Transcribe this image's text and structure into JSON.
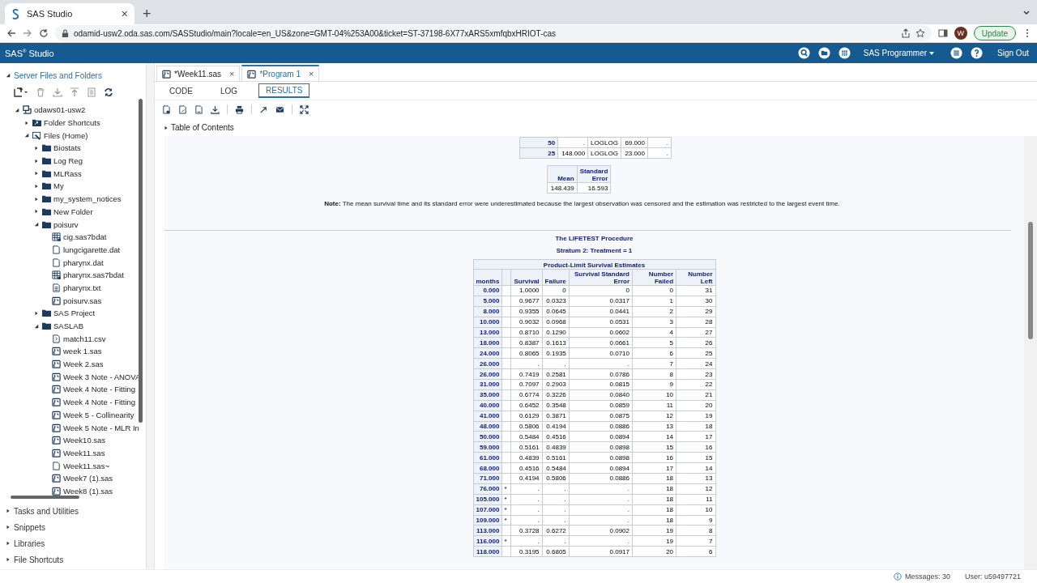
{
  "browser": {
    "tab": {
      "title": "SAS Studio",
      "close": "×"
    },
    "new_tab": "+",
    "url": "odamid-usw2.oda.sas.com/SASStudio/main?locale=en_US&zone=GMT-04%253A00&ticket=ST-37198-6X77xARS5xmfqbxHRIOT-cas",
    "avatar": "W",
    "update_button": "Update"
  },
  "app_header": {
    "product": "SAS",
    "product_mark": "®",
    "product_suffix": "Studio",
    "role": "SAS Programmer",
    "sign_out": "Sign Out"
  },
  "sidebar": {
    "title": "Server Files and Folders",
    "expanded": true,
    "tree": [
      {
        "label": "odaws01-usw2",
        "kind": "server",
        "expanded": true,
        "children": [
          {
            "label": "Folder Shortcuts",
            "kind": "shortcut",
            "expanded": false
          },
          {
            "label": "Files (Home)",
            "kind": "home",
            "expanded": true,
            "children": [
              {
                "label": "Biostats",
                "kind": "folder",
                "expanded": false
              },
              {
                "label": "Log Reg",
                "kind": "folder",
                "expanded": false
              },
              {
                "label": "MLRass",
                "kind": "folder",
                "expanded": false
              },
              {
                "label": "My",
                "kind": "folder",
                "expanded": false
              },
              {
                "label": "my_system_notices",
                "kind": "folder",
                "expanded": false
              },
              {
                "label": "New Folder",
                "kind": "folder",
                "expanded": false
              },
              {
                "label": "poisurv",
                "kind": "folder",
                "expanded": true,
                "children": [
                  {
                    "label": "cig.sas7bdat",
                    "kind": "dataset"
                  },
                  {
                    "label": "lungcigarette.dat",
                    "kind": "file"
                  },
                  {
                    "label": "pharynx.dat",
                    "kind": "file"
                  },
                  {
                    "label": "pharynx.sas7bdat",
                    "kind": "dataset"
                  },
                  {
                    "label": "pharynx.txt",
                    "kind": "text"
                  },
                  {
                    "label": "poisurv.sas",
                    "kind": "program"
                  }
                ]
              },
              {
                "label": "SAS Project",
                "kind": "folder",
                "expanded": false
              },
              {
                "label": "SASLAB",
                "kind": "folder",
                "expanded": true,
                "children": [
                  {
                    "label": "match11.csv",
                    "kind": "csv"
                  },
                  {
                    "label": "week 1.sas",
                    "kind": "program"
                  },
                  {
                    "label": "Week 2.sas",
                    "kind": "program"
                  },
                  {
                    "label": "Week 3 Note - ANOVA",
                    "kind": "program"
                  },
                  {
                    "label": "Week 4 Note - Fitting",
                    "kind": "program"
                  },
                  {
                    "label": "Week 4 Note - Fitting",
                    "kind": "program"
                  },
                  {
                    "label": "Week 5 - Collinearity",
                    "kind": "program"
                  },
                  {
                    "label": "Week 5 Note - MLR In",
                    "kind": "program"
                  },
                  {
                    "label": "Week10.sas",
                    "kind": "program"
                  },
                  {
                    "label": "Week11.sas",
                    "kind": "program"
                  },
                  {
                    "label": "Week11.sas~",
                    "kind": "file"
                  },
                  {
                    "label": "Week7 (1).sas",
                    "kind": "program"
                  },
                  {
                    "label": "Week8 (1).sas",
                    "kind": "program"
                  }
                ]
              }
            ]
          }
        ]
      }
    ],
    "sections": [
      {
        "label": "Tasks and Utilities",
        "expanded": false
      },
      {
        "label": "Snippets",
        "expanded": false
      },
      {
        "label": "Libraries",
        "expanded": false
      },
      {
        "label": "File Shortcuts",
        "expanded": false
      }
    ]
  },
  "editor_tabs": [
    {
      "label": "*Week11.sas",
      "selected": false,
      "close": "×"
    },
    {
      "label": "*Program 1",
      "selected": true,
      "close": "×"
    }
  ],
  "view_tabs": [
    {
      "label": "CODE",
      "selected": false
    },
    {
      "label": "LOG",
      "selected": false
    },
    {
      "label": "RESULTS",
      "selected": true
    }
  ],
  "toc": {
    "label": "Table of Contents",
    "expanded": false
  },
  "results": {
    "quartile_rows": [
      [
        "50",
        ".",
        "LOGLOG",
        "69.000",
        "."
      ],
      [
        "25",
        "148.000",
        "LOGLOG",
        "23.000",
        "."
      ]
    ],
    "mean_table": {
      "columns": [
        "Mean",
        "Standard Error"
      ],
      "row": [
        "148.439",
        "16.593"
      ]
    },
    "note": "**Note:** The mean survival time and its standard error were underestimated because the largest observation was censored and the estimation was restricted to the largest event time.",
    "procedure_title": "The LIFETEST Procedure",
    "stratum_title": "Stratum 2: Treatment = 1",
    "estimates": {
      "title": "Product-Limit Survival Estimates",
      "columns": [
        "months",
        "",
        "Survival",
        "Failure",
        "Survival Standard Error",
        "Number Failed",
        "Number Left"
      ],
      "rows": [
        [
          "0.000",
          "",
          "1.0000",
          "0",
          "0",
          "0",
          "31"
        ],
        [
          "5.000",
          "",
          "0.9677",
          "0.0323",
          "0.0317",
          "1",
          "30"
        ],
        [
          "8.000",
          "",
          "0.9355",
          "0.0645",
          "0.0441",
          "2",
          "29"
        ],
        [
          "10.000",
          "",
          "0.9032",
          "0.0968",
          "0.0531",
          "3",
          "28"
        ],
        [
          "13.000",
          "",
          "0.8710",
          "0.1290",
          "0.0602",
          "4",
          "27"
        ],
        [
          "18.000",
          "",
          "0.8387",
          "0.1613",
          "0.0661",
          "5",
          "26"
        ],
        [
          "24.000",
          "",
          "0.8065",
          "0.1935",
          "0.0710",
          "6",
          "25"
        ],
        [
          "26.000",
          "",
          ".",
          ".",
          ".",
          "7",
          "24"
        ],
        [
          "26.000",
          "",
          "0.7419",
          "0.2581",
          "0.0786",
          "8",
          "23"
        ],
        [
          "31.000",
          "",
          "0.7097",
          "0.2903",
          "0.0815",
          "9",
          "22"
        ],
        [
          "35.000",
          "",
          "0.6774",
          "0.3226",
          "0.0840",
          "10",
          "21"
        ],
        [
          "40.000",
          "",
          "0.6452",
          "0.3548",
          "0.0859",
          "11",
          "20"
        ],
        [
          "41.000",
          "",
          "0.6129",
          "0.3871",
          "0.0875",
          "12",
          "19"
        ],
        [
          "48.000",
          "",
          "0.5806",
          "0.4194",
          "0.0886",
          "13",
          "18"
        ],
        [
          "50.000",
          "",
          "0.5484",
          "0.4516",
          "0.0894",
          "14",
          "17"
        ],
        [
          "59.000",
          "",
          "0.5161",
          "0.4839",
          "0.0898",
          "15",
          "16"
        ],
        [
          "61.000",
          "",
          "0.4839",
          "0.5161",
          "0.0898",
          "16",
          "15"
        ],
        [
          "68.000",
          "",
          "0.4516",
          "0.5484",
          "0.0894",
          "17",
          "14"
        ],
        [
          "71.000",
          "",
          "0.4194",
          "0.5806",
          "0.0886",
          "18",
          "13"
        ],
        [
          "76.000",
          "*",
          ".",
          ".",
          ".",
          "18",
          "12"
        ],
        [
          "105.000",
          "*",
          ".",
          ".",
          ".",
          "18",
          "11"
        ],
        [
          "107.000",
          "*",
          ".",
          ".",
          ".",
          "18",
          "10"
        ],
        [
          "109.000",
          "*",
          ".",
          ".",
          ".",
          "18",
          "9"
        ],
        [
          "113.000",
          "",
          "0.3728",
          "0.6272",
          "0.0902",
          "19",
          "8"
        ],
        [
          "116.000",
          "*",
          ".",
          ".",
          ".",
          "19",
          "7"
        ],
        [
          "118.000",
          "",
          "0.3195",
          "0.6805",
          "0.0917",
          "20",
          "6"
        ]
      ]
    }
  },
  "status_bar": {
    "messages": "Messages: 30",
    "user": "User: u59497721"
  }
}
